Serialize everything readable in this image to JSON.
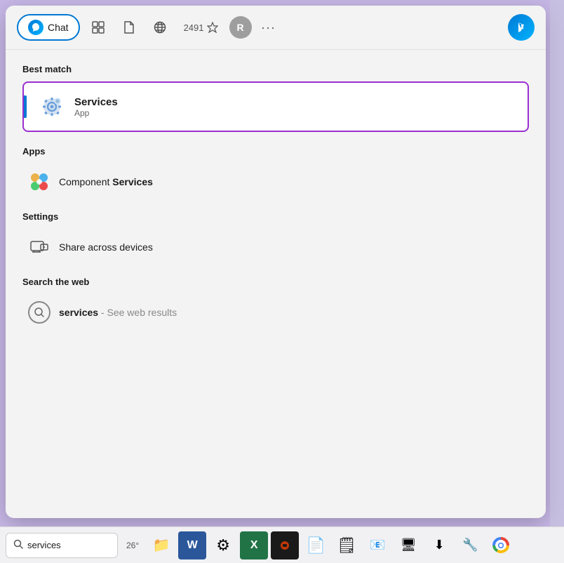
{
  "topbar": {
    "chat_label": "Chat",
    "score": "2491",
    "avatar_label": "R",
    "more_label": "···",
    "bing_label": "b"
  },
  "best_match": {
    "section_label": "Best match",
    "title": "Services",
    "subtitle": "App"
  },
  "apps": {
    "section_label": "Apps",
    "items": [
      {
        "label": "Component Services",
        "bold_part": "Services"
      }
    ]
  },
  "settings": {
    "section_label": "Settings",
    "items": [
      {
        "label": "Share across devices"
      }
    ]
  },
  "web": {
    "section_label": "Search the web",
    "items": [
      {
        "query": "services",
        "suffix": "- See web results"
      }
    ]
  },
  "taskbar": {
    "search_text": "services",
    "search_placeholder": "Search",
    "weather": "26°",
    "apps": [
      {
        "name": "file-explorer",
        "icon": "📁"
      },
      {
        "name": "word",
        "icon": "W"
      },
      {
        "name": "settings",
        "icon": "⚙"
      },
      {
        "name": "excel",
        "icon": "X"
      },
      {
        "name": "terminal",
        "icon": "⬛"
      },
      {
        "name": "file",
        "icon": "📄"
      },
      {
        "name": "file2",
        "icon": "📄"
      },
      {
        "name": "outlook",
        "icon": "📧"
      },
      {
        "name": "display",
        "icon": "🖥"
      },
      {
        "name": "download",
        "icon": "⬇"
      },
      {
        "name": "tools",
        "icon": "🔧"
      },
      {
        "name": "chrome",
        "icon": "🌐"
      }
    ]
  }
}
